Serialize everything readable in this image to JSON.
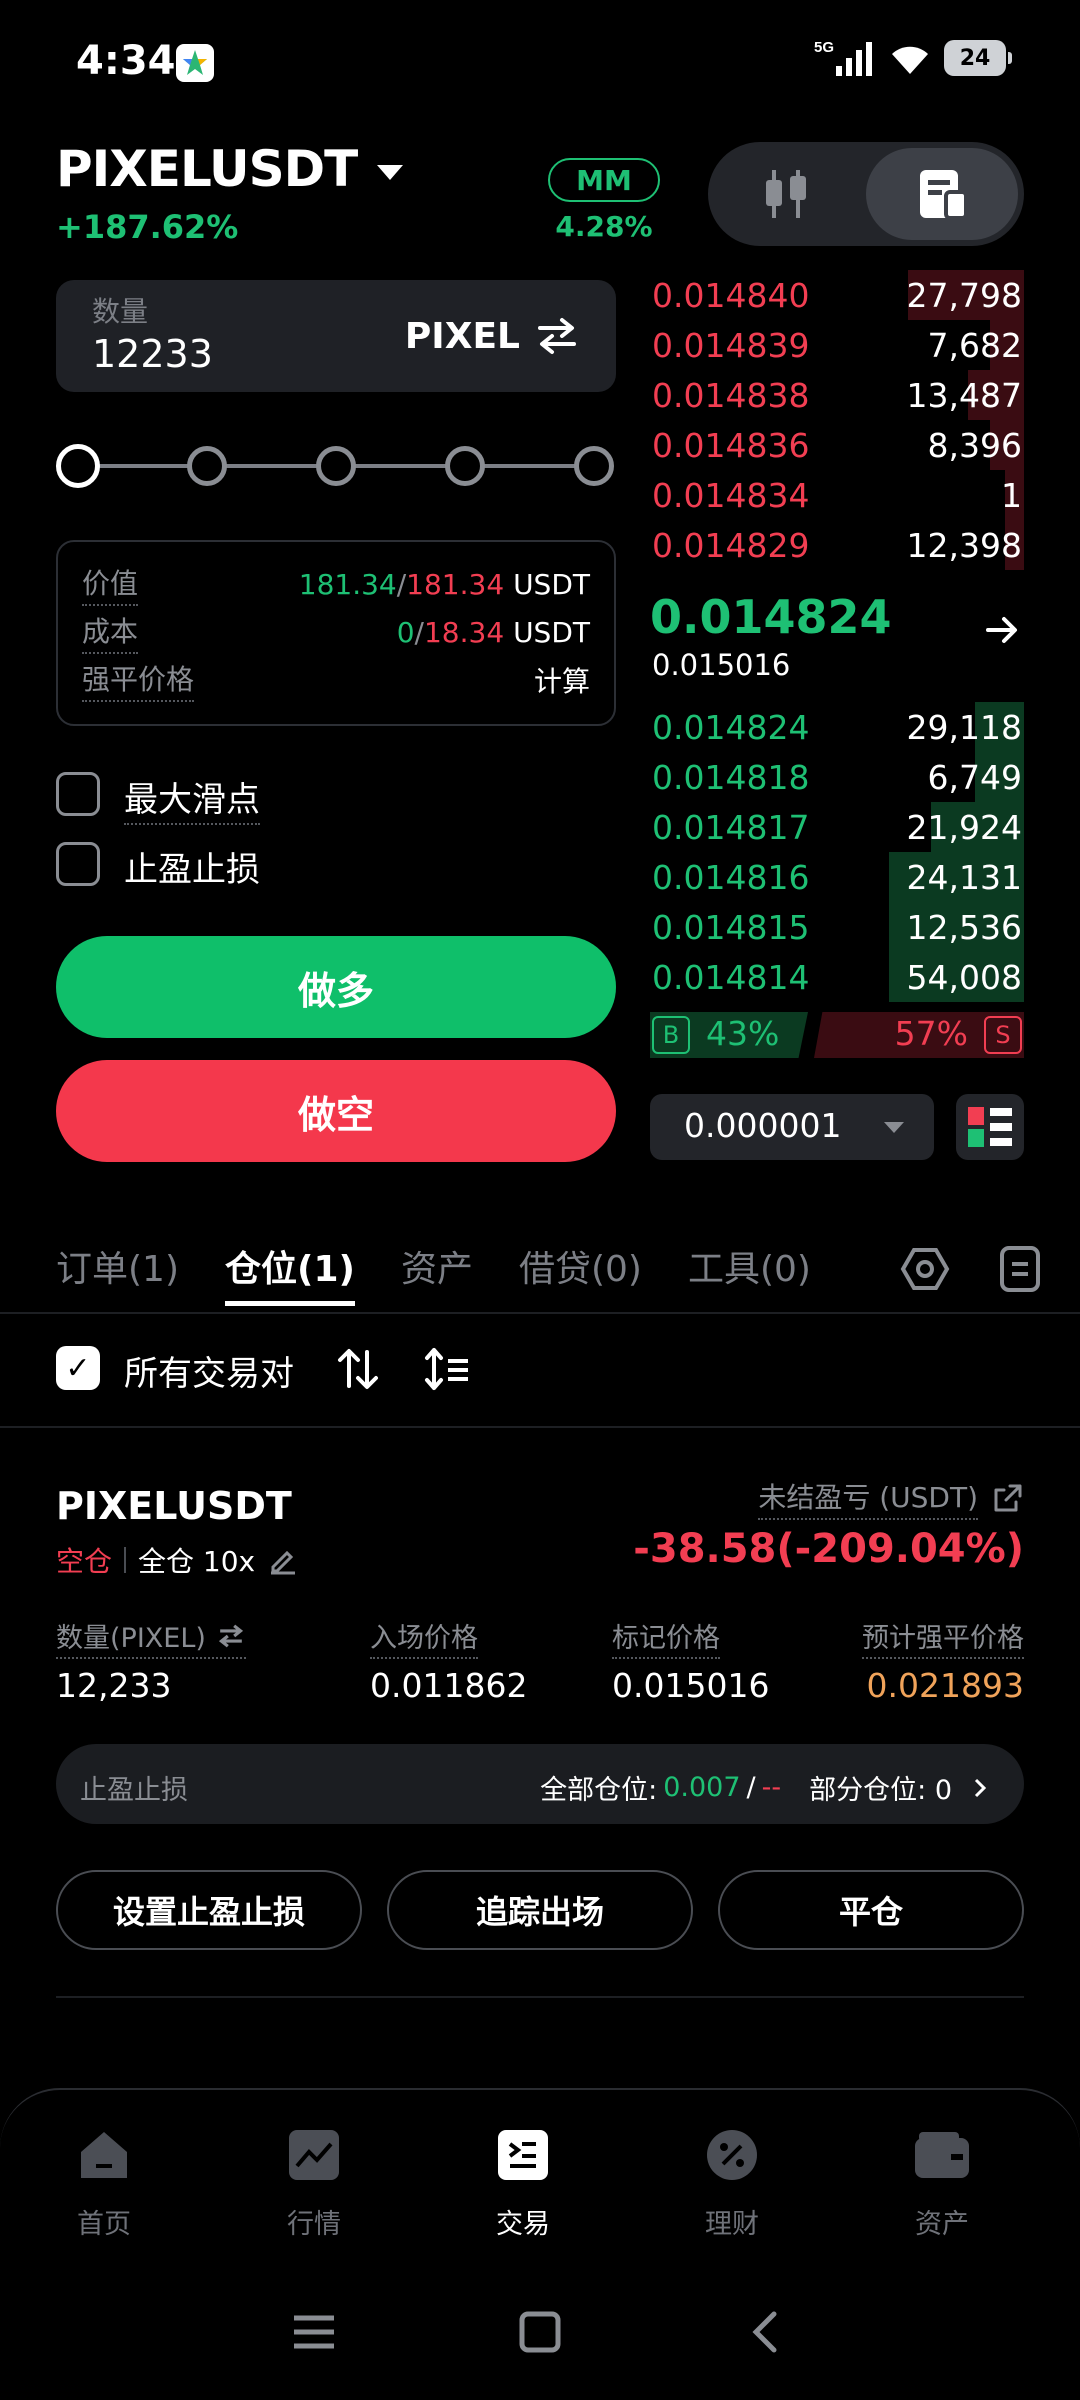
{
  "status": {
    "time": "4:34",
    "network": "5G",
    "battery": "24"
  },
  "header": {
    "pair": "PIXELUSDT",
    "change_pct": "+187.62%",
    "mm_label": "MM",
    "mm_pct": "4.28%"
  },
  "order_form": {
    "qty_label": "数量",
    "qty_value": "12233",
    "qty_unit": "PIXEL",
    "info": {
      "value_label": "价值",
      "value_green": "181.34",
      "value_red": "181.34",
      "cost_label": "成本",
      "cost_green": "0",
      "cost_red": "18.34",
      "unit": "USDT",
      "slash": "/",
      "liq_label": "强平价格",
      "liq_action": "计算"
    },
    "max_slippage": "最大滑点",
    "tpsl": "止盈止损",
    "long_button": "做多",
    "short_button": "做空"
  },
  "orderbook": {
    "asks": [
      {
        "price": "0.014840",
        "size": "27,798",
        "depth": 0.31
      },
      {
        "price": "0.014839",
        "size": "7,682",
        "depth": 0.09
      },
      {
        "price": "0.014838",
        "size": "13,487",
        "depth": 0.15
      },
      {
        "price": "0.014836",
        "size": "8,396",
        "depth": 0.09
      },
      {
        "price": "0.014834",
        "size": "1",
        "depth": 0.05
      },
      {
        "price": "0.014829",
        "size": "12,398",
        "depth": 0.05
      }
    ],
    "mid_price": "0.014824",
    "mark_price": "0.015016",
    "bids": [
      {
        "price": "0.014824",
        "size": "29,118",
        "depth": 0.13
      },
      {
        "price": "0.014818",
        "size": "6,749",
        "depth": 0.13
      },
      {
        "price": "0.014817",
        "size": "21,924",
        "depth": 0.25
      },
      {
        "price": "0.014816",
        "size": "24,131",
        "depth": 0.36
      },
      {
        "price": "0.014815",
        "size": "12,536",
        "depth": 0.36
      },
      {
        "price": "0.014814",
        "size": "54,008",
        "depth": 0.36
      }
    ],
    "buy_tag": "B",
    "buy_pct": "43%",
    "sell_pct": "57%",
    "sell_tag": "S",
    "precision": "0.000001"
  },
  "tabs": [
    "订单(1)",
    "仓位(1)",
    "资产",
    "借贷(0)",
    "工具(0)"
  ],
  "filter": {
    "all_pairs": "所有交易对"
  },
  "position": {
    "symbol": "PIXELUSDT",
    "side": "空仓",
    "margin_mode": "全仓 10x",
    "pnl_label": "未结盈亏 (USDT)",
    "pnl_value": "-38.58(-209.04%)",
    "qty_label": "数量(PIXEL)",
    "qty_value": "12,233",
    "entry_label": "入场价格",
    "entry_value": "0.011862",
    "mark_label": "标记价格",
    "mark_value": "0.015016",
    "liq_label": "预计强平价格",
    "liq_value": "0.021893",
    "tpsl_label": "止盈止损",
    "tpsl_all_label": "全部仓位:",
    "tpsl_all_tp": "0.007",
    "tpsl_all_sl": "--",
    "tpsl_partial_label": "部分仓位: 0",
    "slash": "/",
    "btn_set_tpsl": "设置止盈止损",
    "btn_trailing": "追踪出场",
    "btn_close": "平仓"
  },
  "bottom_nav": [
    "首页",
    "行情",
    "交易",
    "理财",
    "资产"
  ]
}
